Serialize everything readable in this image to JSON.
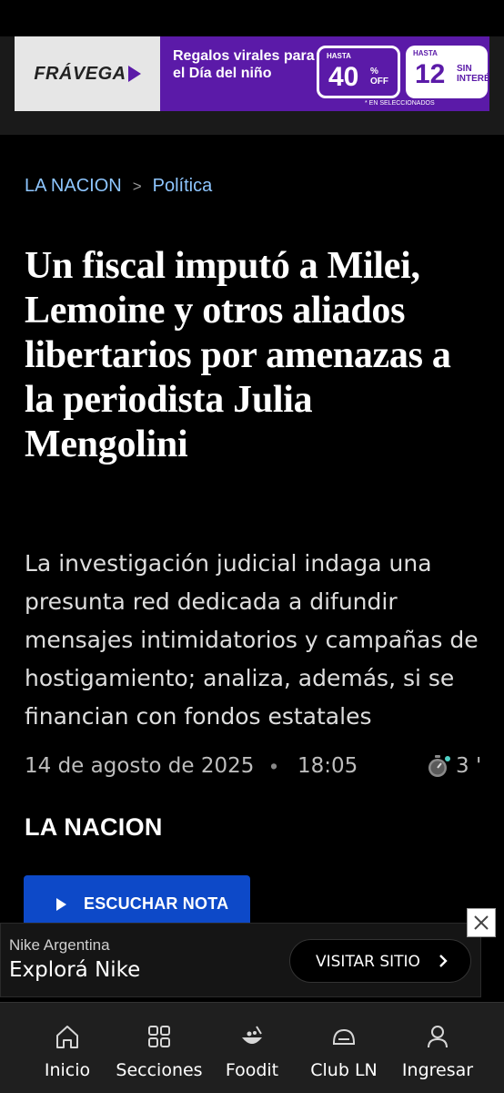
{
  "top_ad": {
    "brand": "FRÁVEGA",
    "promo_text": "Regalos virales para el Día del niño",
    "badge1_small": "HASTA",
    "badge1_big": "40",
    "badge1_suffix": "% OFF",
    "badge2_small": "HASTA",
    "badge2_big": "12",
    "badge2_suffix": "SIN INTERÉS",
    "fineprint": "* EN SELECCIONADOS",
    "brand_color": "#5b1aa8"
  },
  "breadcrumb": {
    "home": "LA NACION",
    "separator": ">",
    "section": "Política"
  },
  "article": {
    "headline": "Un fiscal imputó a Milei, Lemoine y otros aliados libertarios por amenazas a la periodista Julia Mengolini",
    "dek": "La investigación judicial indaga una presunta red dedicada a difundir mensajes intimidatorios y campañas de hostigamiento; analiza, además, si se financian con fondos estatales",
    "date": "14 de agosto de 2025",
    "dot": "•",
    "time": "18:05",
    "read_time": "3 '",
    "timer_icon": "stopwatch-icon",
    "author": "LA NACION",
    "listen_label": "ESCUCHAR NOTA",
    "listen_color": "#0d49c8"
  },
  "bottom_ad": {
    "advertiser": "Nike Argentina",
    "title": "Explorá Nike",
    "cta": "VISITAR SITIO"
  },
  "nav": {
    "items": [
      {
        "label": "Inicio",
        "icon": "home-icon"
      },
      {
        "label": "Secciones",
        "icon": "grid-icon"
      },
      {
        "label": "Foodit",
        "icon": "food-icon"
      },
      {
        "label": "Club LN",
        "icon": "club-icon"
      },
      {
        "label": "Ingresar",
        "icon": "user-icon"
      }
    ]
  }
}
